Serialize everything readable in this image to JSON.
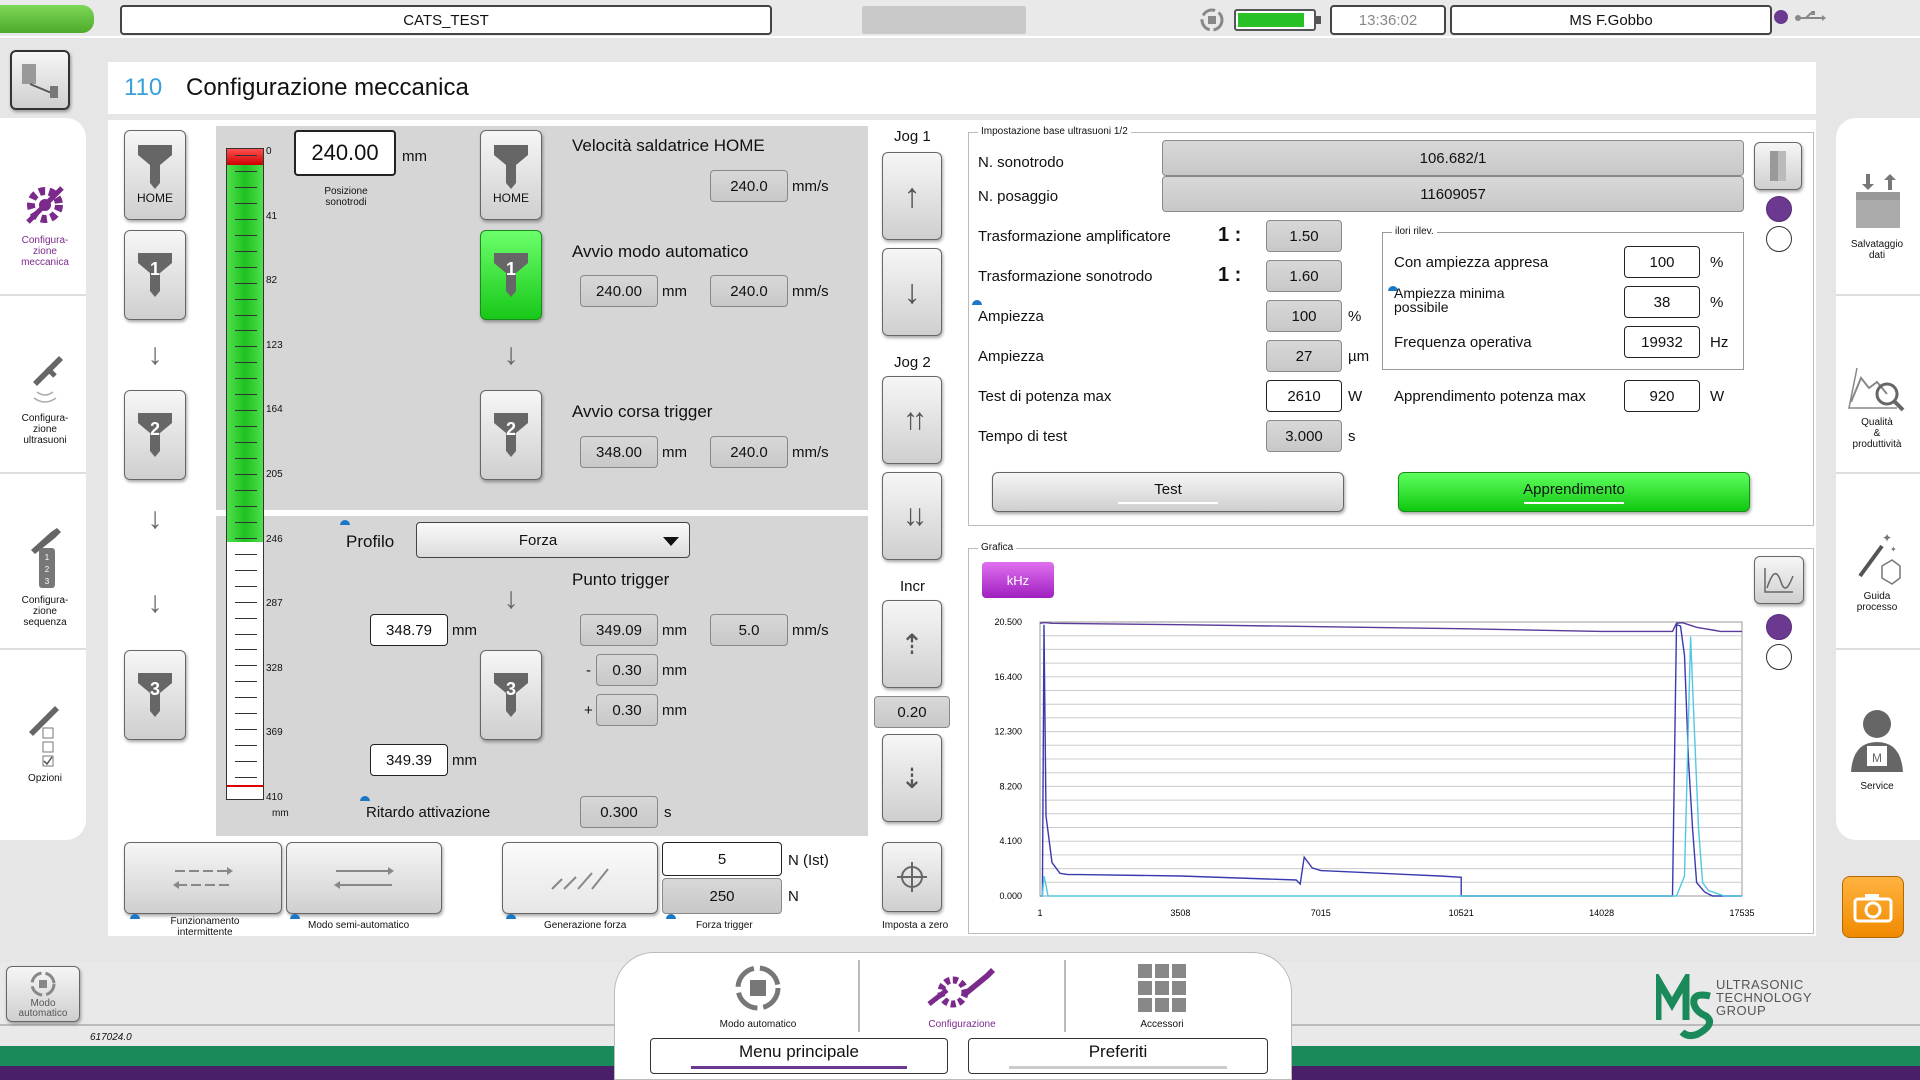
{
  "topbar": {
    "project": "CATS_TEST",
    "time": "13:36:02",
    "user": "MS F.Gobbo"
  },
  "page": {
    "number": "110",
    "title": "Configurazione meccanica"
  },
  "left_nav": [
    {
      "label": "Configura-\nzione\nmeccanica",
      "icon": "gear-wrench-icon",
      "active": true
    },
    {
      "label": "Configura-\nzione\nultrasuoni",
      "icon": "wrench-waves-icon"
    },
    {
      "label": "Configura-\nzione\nsequenza",
      "icon": "wrench-sequence-icon"
    },
    {
      "label": "Opzioni",
      "icon": "wrench-checklist-icon"
    }
  ],
  "right_nav": [
    {
      "label": "Salvataggio\ndati",
      "icon": "save-data-icon"
    },
    {
      "label": "Qualità\n&\nproduttività",
      "icon": "quality-chart-icon"
    },
    {
      "label": "Guida\nprocesso",
      "icon": "magic-wand-icon"
    },
    {
      "label": "Service",
      "icon": "service-person-icon"
    }
  ],
  "scale": {
    "ticks": [
      "0",
      "41",
      "82",
      "123",
      "164",
      "205",
      "246",
      "287",
      "328",
      "369",
      "410"
    ],
    "unit": "mm",
    "green_fraction": 0.6
  },
  "position": {
    "value": "240.00",
    "unit": "mm",
    "caption": "Posizione\nsonotrodi"
  },
  "sono_buttons": {
    "home": "HOME",
    "one": "1",
    "two": "2",
    "three": "3"
  },
  "home_section": {
    "title": "Velocità saldatrice HOME",
    "speed": "240.0",
    "speed_unit": "mm/s"
  },
  "auto_section": {
    "title": "Avvio modo automatico",
    "pos": "240.00",
    "pos_unit": "mm",
    "speed": "240.0",
    "speed_unit": "mm/s"
  },
  "trigger_section": {
    "title": "Avvio corsa trigger",
    "pos": "348.00",
    "pos_unit": "mm",
    "speed": "240.0",
    "speed_unit": "mm/s"
  },
  "profile": {
    "label": "Profilo",
    "selected": "Forza"
  },
  "trigger_point": {
    "title": "Punto trigger",
    "left_pos": "348.79",
    "pos": "349.09",
    "speed": "5.0",
    "minus_sign": "-",
    "minus": "0.30",
    "plus_sign": "+",
    "plus": "0.30",
    "lower_pos": "349.39",
    "unit_mm": "mm",
    "unit_speed": "mm/s"
  },
  "delay": {
    "label": "Ritardo attivazione",
    "value": "0.300",
    "unit": "s"
  },
  "jog": {
    "jog1": "Jog 1",
    "jog2": "Jog 2",
    "incr": "Incr",
    "incr_value": "0.20",
    "zero": "Imposta a zero"
  },
  "bottom_buttons": [
    {
      "label": "Funzionamento\nintermittente"
    },
    {
      "label": "Modo semi-automatico"
    },
    {
      "label": "Generazione forza"
    },
    {
      "label": "Forza trigger"
    }
  ],
  "force": {
    "ist": "5",
    "ist_unit": "N (Ist)",
    "trigger": "250",
    "trigger_unit": "N"
  },
  "ultrasound": {
    "legend": "Impostazione base ultrasuoni 1/2",
    "sonotrode_label": "N. sonotrodo",
    "sonotrode": "106.682/1",
    "fixture_label": "N. posaggio",
    "fixture": "11609057",
    "amp_trans_label": "Trasformazione amplificatore",
    "amp_ratio": "1 :",
    "amp_trans": "1.50",
    "sono_trans_label": "Trasformazione sonotrodo",
    "sono_ratio": "1 :",
    "sono_trans": "1.60",
    "ampl_pct_label": "Ampiezza",
    "ampl_pct": "100",
    "ampl_pct_unit": "%",
    "ampl_um_label": "Ampiezza",
    "ampl_um": "27",
    "ampl_um_unit": "µm",
    "power_test_label": "Test di potenza max",
    "power_test": "2610",
    "power_test_unit": "W",
    "test_time_label": "Tempo di test",
    "test_time": "3.000",
    "test_time_unit": "s",
    "measured_legend": "ilori rilev.",
    "with_amp_label": "Con ampiezza appresa",
    "with_amp": "100",
    "with_amp_unit": "%",
    "min_amp_label": "Ampiezza minima\npossibile",
    "min_amp": "38",
    "min_amp_unit": "%",
    "freq_label": "Frequenza operativa",
    "freq": "19932",
    "freq_unit": "Hz",
    "learn_power_label": "Apprendimento potenza max",
    "learn_power": "920",
    "learn_power_unit": "W",
    "test_button": "Test",
    "learn_button": "Apprendimento"
  },
  "graph": {
    "legend": "Grafica",
    "unit_button": "kHz"
  },
  "chart_data": {
    "type": "line",
    "x_ticks": [
      "1",
      "3508",
      "7015",
      "10521",
      "14028",
      "17535"
    ],
    "y_ticks": [
      "20.500",
      "16.400",
      "12.300",
      "8.200",
      "4.100",
      "0.000"
    ],
    "xlim": [
      1,
      17535
    ],
    "ylim": [
      0,
      20.5
    ],
    "series": [
      {
        "color": "#5a3a9a",
        "x": [
          1,
          80,
          150,
          300,
          3508,
          7015,
          10521,
          14028,
          15800,
          15900,
          16050,
          16200,
          16400,
          16600,
          16800,
          17000,
          17535
        ],
        "y": [
          20.4,
          20.45,
          20.45,
          20.4,
          20.3,
          20.15,
          20.0,
          19.8,
          19.8,
          20.4,
          20.45,
          20.3,
          20.1,
          20.0,
          19.9,
          19.8,
          19.8
        ]
      },
      {
        "color": "#3a3ab0",
        "x": [
          1,
          60,
          100,
          150,
          300,
          500,
          700,
          1000,
          3508,
          6400,
          6500,
          6600,
          6800,
          7015,
          10000,
          10521,
          10522,
          15700,
          15800,
          15900,
          16000,
          16100,
          16200,
          16300,
          16400,
          16600,
          16800,
          17000,
          17535
        ],
        "y": [
          0,
          0,
          20.3,
          6,
          2.5,
          1.7,
          1.6,
          1.6,
          1.5,
          1.2,
          0.9,
          2.9,
          2.1,
          1.9,
          1.5,
          1.4,
          0,
          0,
          0,
          20.3,
          20.2,
          18,
          10,
          5,
          1,
          0.3,
          0,
          0,
          0
        ]
      },
      {
        "color": "#52c8e0",
        "x": [
          1,
          60,
          100,
          150,
          200,
          300,
          1000,
          3508,
          7015,
          10521,
          14028,
          15900,
          16100,
          16250,
          16350,
          16450,
          16550,
          16700,
          16900,
          17100,
          17535
        ],
        "y": [
          0,
          0,
          1.5,
          0.8,
          0,
          0,
          0,
          0,
          0,
          0,
          0,
          0,
          1.5,
          19.4,
          12,
          5,
          1,
          0.4,
          0.2,
          0,
          0
        ]
      }
    ]
  },
  "bottom_tabs": [
    {
      "label": "Modo automatico",
      "icon": "auto-mode-icon"
    },
    {
      "label": "Configurazione",
      "icon": "config-wrench-icon",
      "active": true
    },
    {
      "label": "Accessori",
      "icon": "grid-icon"
    }
  ],
  "menu_main": "Menu principale",
  "favorites": "Preferiti",
  "auto_corner": "Modo\nautomatico",
  "version": "617024.0",
  "logo": {
    "text": "ULTRASONIC\nTECHNOLOGY\nGROUP"
  }
}
